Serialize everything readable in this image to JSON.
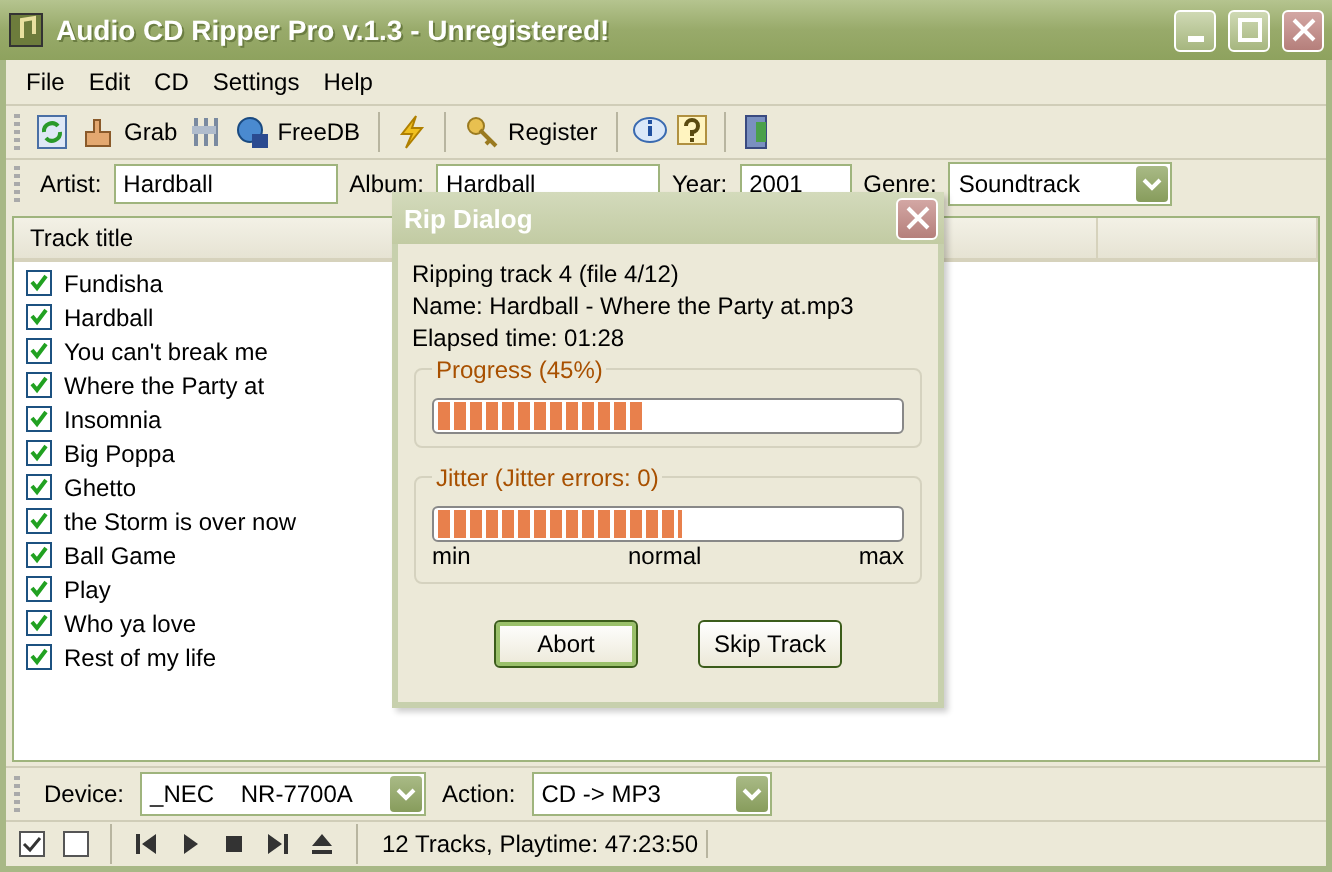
{
  "window": {
    "title": "Audio CD Ripper Pro v.1.3 - Unregistered!"
  },
  "menu": [
    "File",
    "Edit",
    "CD",
    "Settings",
    "Help"
  ],
  "toolbar": {
    "grab": "Grab",
    "freedb": "FreeDB",
    "register": "Register"
  },
  "fields": {
    "artist": {
      "label": "Artist:",
      "value": "Hardball"
    },
    "album": {
      "label": "Album:",
      "value": "Hardball"
    },
    "year": {
      "label": "Year:",
      "value": "2001"
    },
    "genre": {
      "label": "Genre:",
      "value": "Soundtrack"
    }
  },
  "table": {
    "columns": [
      "Track title"
    ],
    "rows": [
      {
        "title": "Fundisha",
        "checked": true
      },
      {
        "title": "Hardball",
        "checked": true
      },
      {
        "title": "You can't break me",
        "checked": true
      },
      {
        "title": "Where the Party at",
        "checked": true
      },
      {
        "title": "Insomnia",
        "checked": true
      },
      {
        "title": "Big Poppa",
        "checked": true
      },
      {
        "title": "Ghetto",
        "checked": true
      },
      {
        "title": "the Storm is over now",
        "checked": true
      },
      {
        "title": "Ball Game",
        "checked": true
      },
      {
        "title": "Play",
        "checked": true
      },
      {
        "title": "Who ya love",
        "checked": true
      },
      {
        "title": "Rest of my life",
        "checked": true
      }
    ]
  },
  "bottom_bar": {
    "device": {
      "label": "Device:",
      "value": "_NEC    NR-7700A"
    },
    "action": {
      "label": "Action:",
      "value": "CD -> MP3"
    }
  },
  "status_bar": "12 Tracks, Playtime: 47:23:50",
  "dialog": {
    "title": "Rip Dialog",
    "lines": [
      "Ripping track 4 (file 4/12)",
      "Name: Hardball - Where the Party at.mp3",
      "Elapsed time: 01:28"
    ],
    "progress": {
      "label": "Progress (45%)",
      "level": 0.45
    },
    "jitter": {
      "label": "Jitter (Jitter errors: 0)",
      "level": 0.53,
      "scale": [
        "min",
        "normal",
        "max"
      ]
    },
    "buttons": [
      {
        "label": "Abort",
        "focused": true
      },
      {
        "label": "Skip Track",
        "focused": false
      }
    ]
  }
}
